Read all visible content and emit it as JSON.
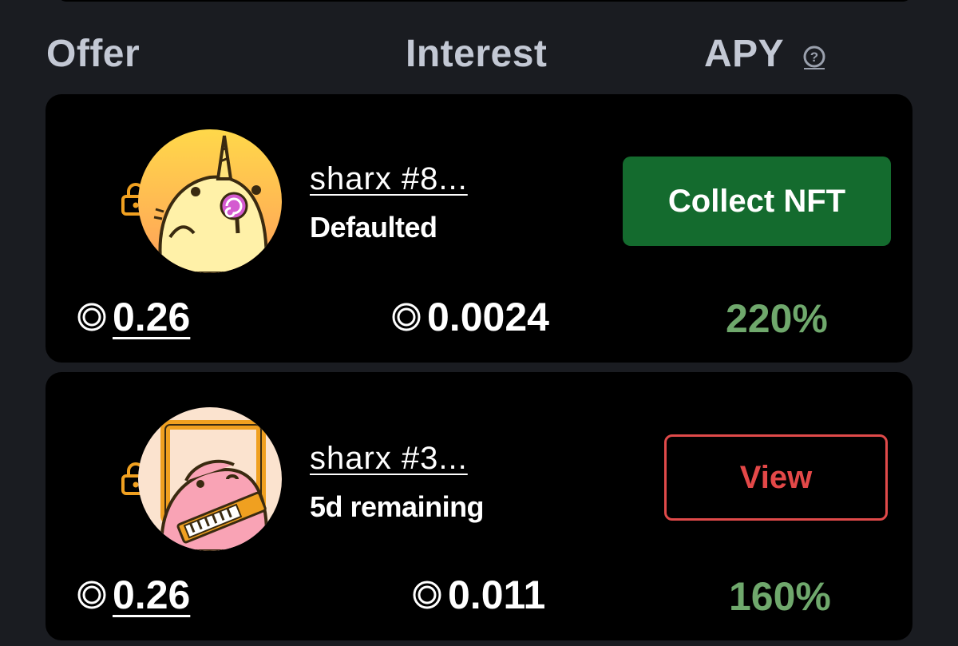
{
  "header": {
    "offer_label": "Offer",
    "interest_label": "Interest",
    "apy_label": "APY",
    "help_icon": "help-question-icon"
  },
  "loans": [
    {
      "nft_name": "sharx #8...",
      "status": "Defaulted",
      "action_label": "Collect NFT",
      "offer": "0.26",
      "interest": "0.0024",
      "apy": "220%",
      "avatar_icon": "narwhal-shark-avatar",
      "lock_icon": "lock-icon"
    },
    {
      "nft_name": "sharx #3...",
      "status": "5d remaining",
      "action_label": "View",
      "offer": "0.26",
      "interest": "0.011",
      "apy": "160%",
      "avatar_icon": "keytar-shark-avatar",
      "lock_icon": "lock-icon"
    }
  ],
  "colors": {
    "background": "#1a1c21",
    "card": "#000000",
    "header_text": "#c3c8d4",
    "collect_button": "#146b2e",
    "view_button_border": "#e04a4a",
    "apy_green": "#6fa86c",
    "lock_orange": "#f0a020"
  }
}
